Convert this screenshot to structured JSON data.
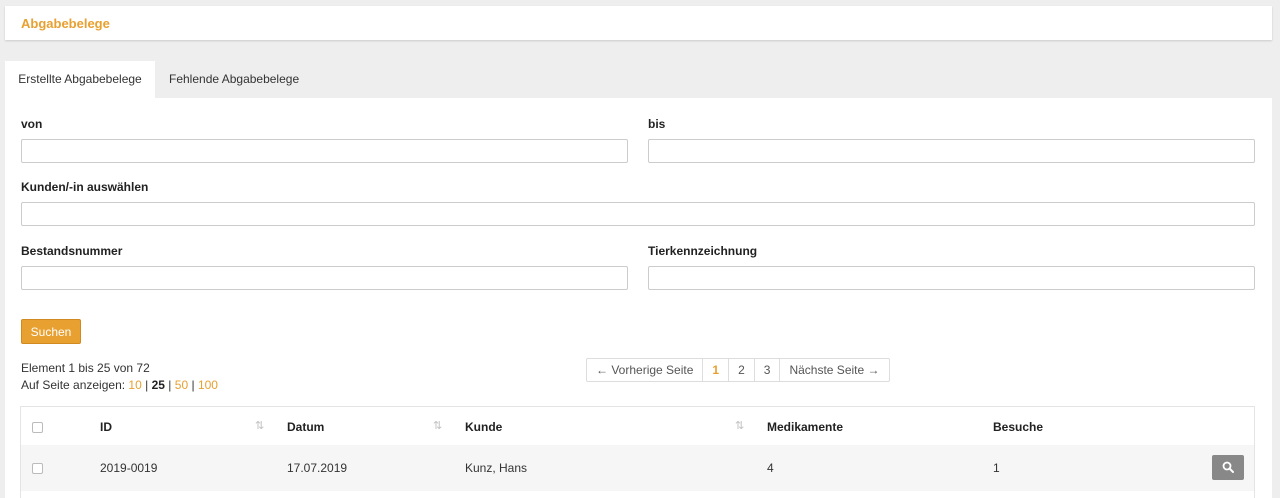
{
  "header": {
    "title": "Abgabebelege"
  },
  "tabs": [
    {
      "label": "Erstellte Abgabebelege",
      "active": true
    },
    {
      "label": "Fehlende Abgabebelege",
      "active": false
    }
  ],
  "filters": {
    "von": {
      "label": "von",
      "value": "",
      "placeholder": ""
    },
    "bis": {
      "label": "bis",
      "value": "",
      "placeholder": ""
    },
    "kunde": {
      "label": "Kunden/-in auswählen",
      "value": "",
      "placeholder": ""
    },
    "bestandsnummer": {
      "label": "Bestandsnummer",
      "value": "",
      "placeholder": ""
    },
    "tierkennzeichnung": {
      "label": "Tierkennzeichnung",
      "value": "",
      "placeholder": ""
    }
  },
  "search_button": "Suchen",
  "results": {
    "summary": "Element 1 bis 25 von 72",
    "per_page_label": "Auf Seite anzeigen:",
    "per_page_options": [
      "10",
      "25",
      "50",
      "100"
    ],
    "per_page_selected": "25",
    "separator": "|"
  },
  "pagination": {
    "prev": "← Vorherige Seite",
    "pages": [
      "1",
      "2",
      "3"
    ],
    "current": "1",
    "next": "Nächste Seite →"
  },
  "table": {
    "columns": [
      "ID",
      "Datum",
      "Kunde",
      "Medikamente",
      "Besuche"
    ],
    "rows": [
      {
        "id": "2019-0019",
        "datum": "17.07.2019",
        "kunde": "Kunz, Hans",
        "medikamente": "4",
        "besuche": "1"
      }
    ]
  },
  "icons": {
    "sort": "sort-arrows-icon",
    "view": "search-icon"
  },
  "colors": {
    "accent": "#e8a030",
    "view_button": "#888888"
  }
}
